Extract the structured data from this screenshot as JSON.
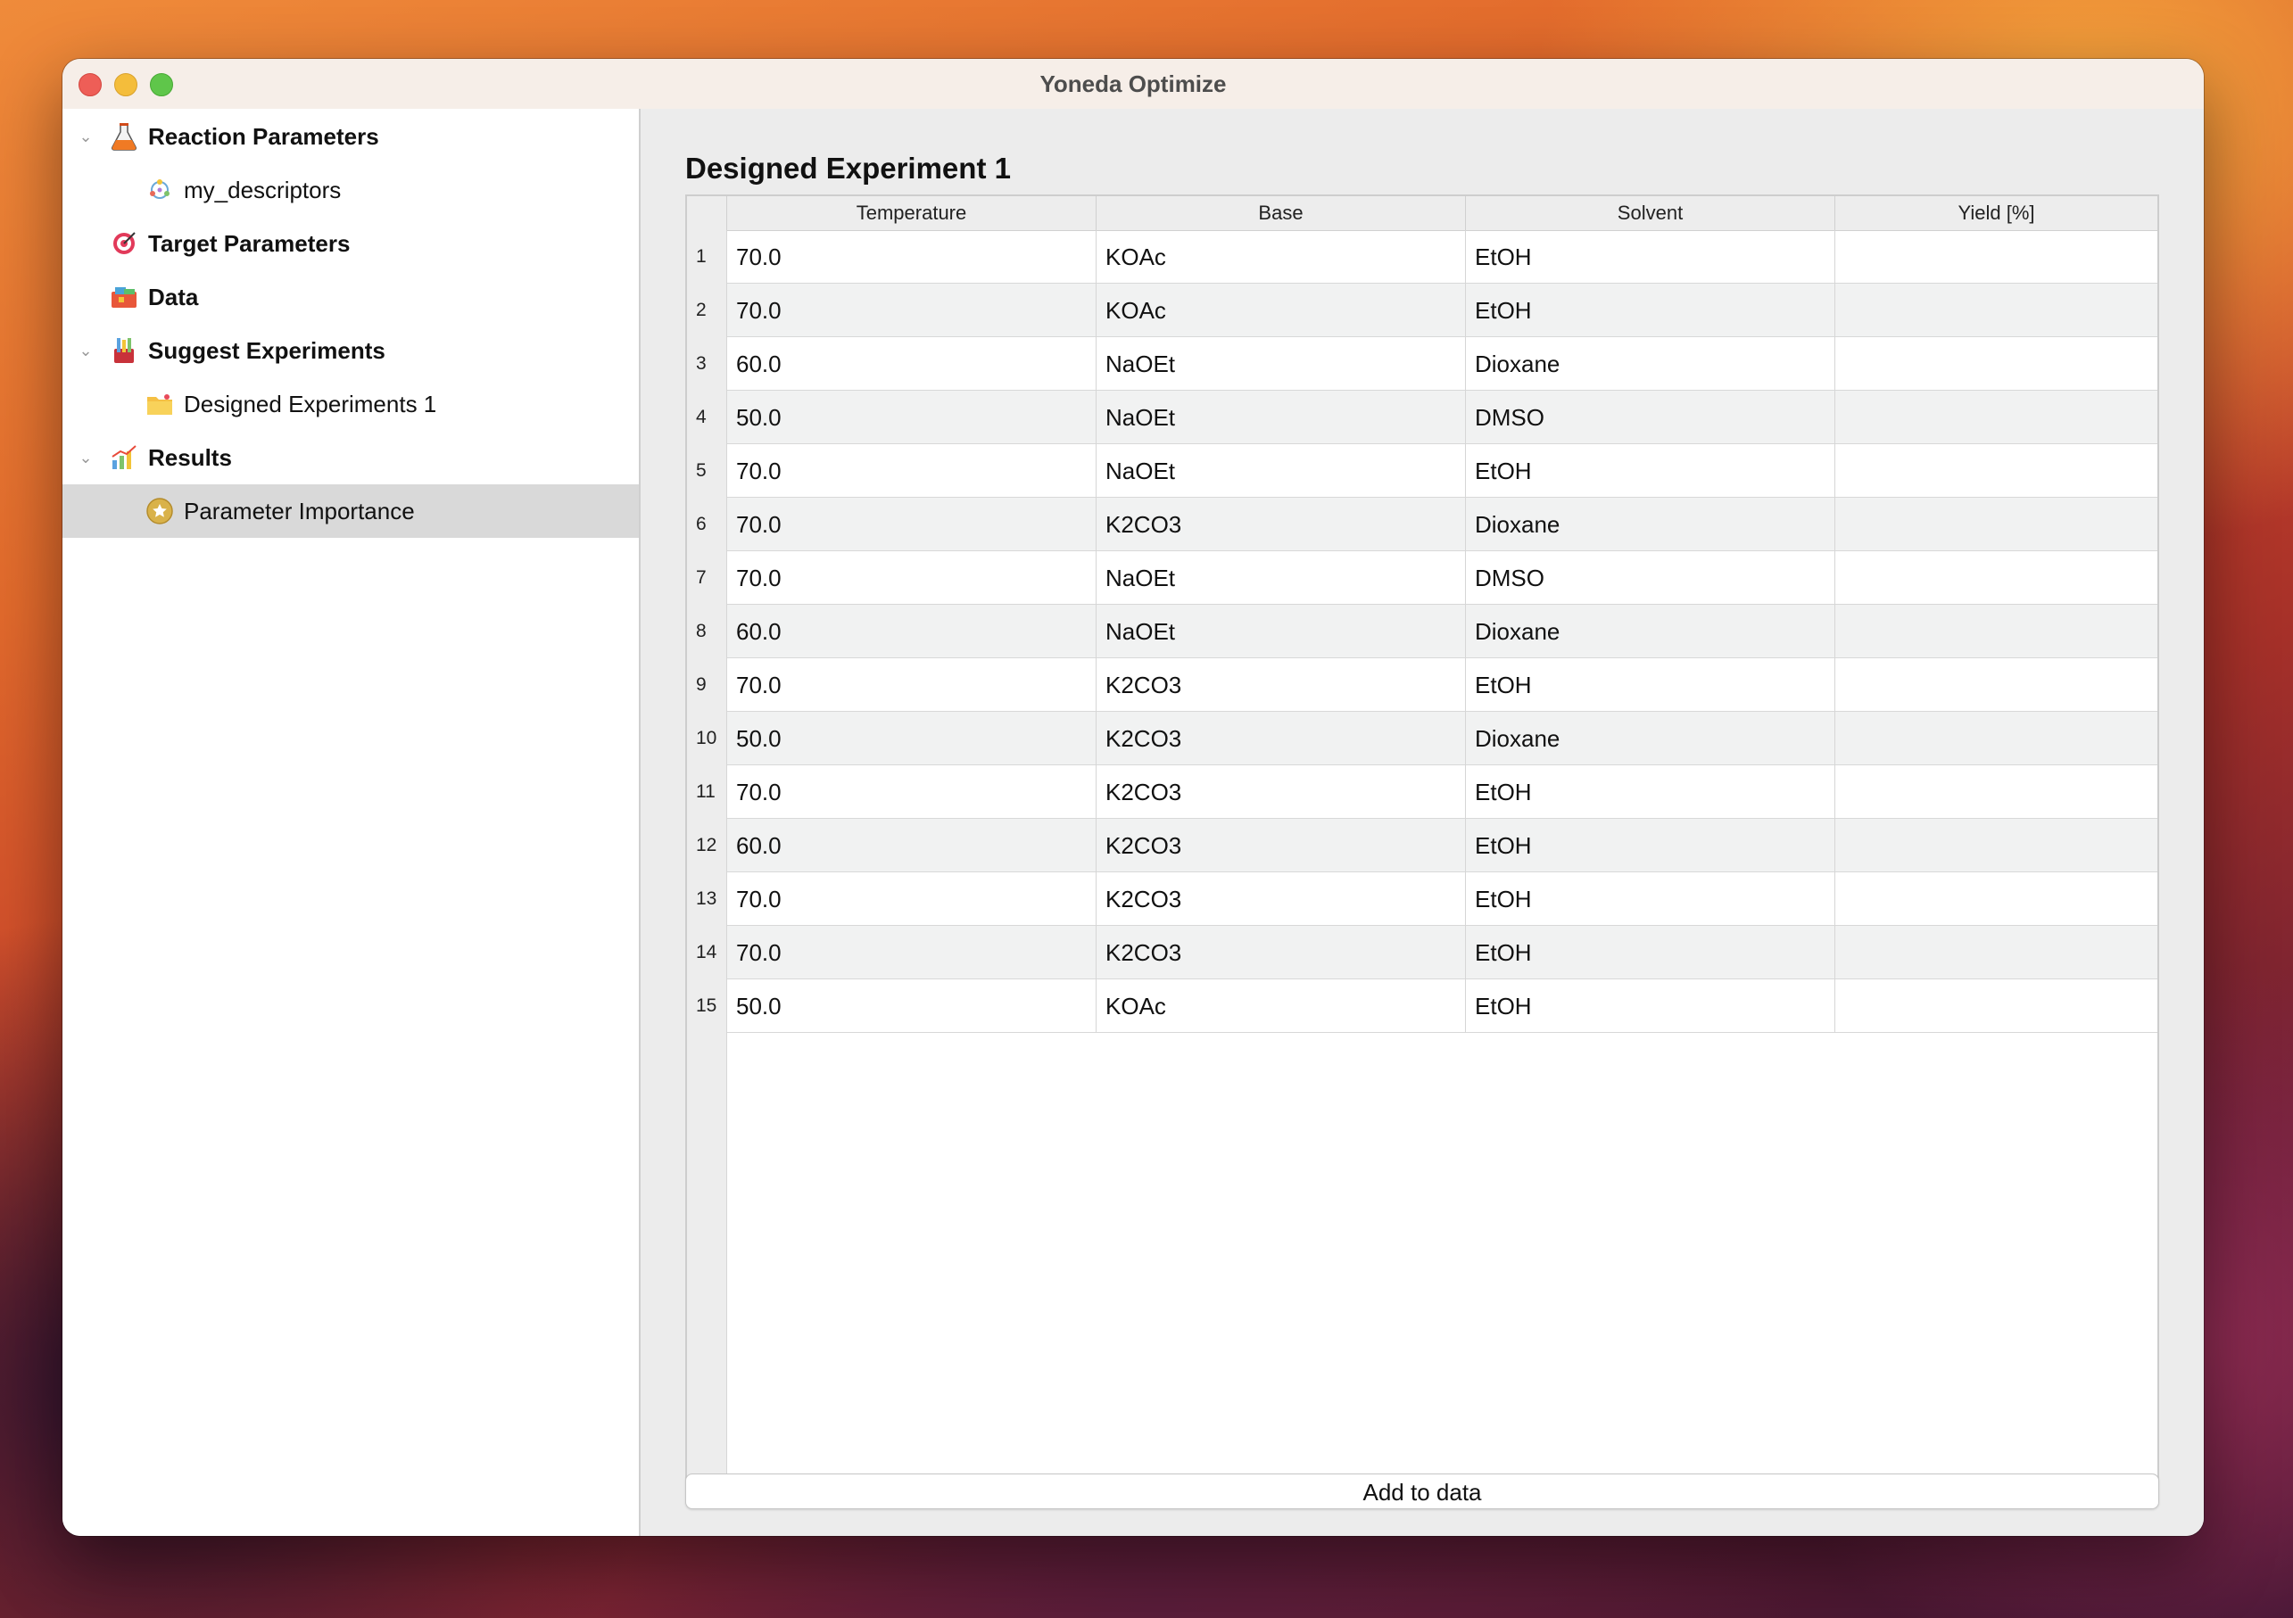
{
  "window": {
    "title": "Yoneda Optimize"
  },
  "sidebar": {
    "items": [
      {
        "label": "Reaction Parameters",
        "icon": "flask-icon",
        "level": 0,
        "bold": true,
        "expanded": true
      },
      {
        "label": "my_descriptors",
        "icon": "molecule-icon",
        "level": 1,
        "bold": false
      },
      {
        "label": "Target Parameters",
        "icon": "target-icon",
        "level": 0,
        "bold": true
      },
      {
        "label": "Data",
        "icon": "data-icon",
        "level": 0,
        "bold": true
      },
      {
        "label": "Suggest Experiments",
        "icon": "test-tubes-icon",
        "level": 0,
        "bold": true,
        "expanded": true
      },
      {
        "label": "Designed Experiments 1",
        "icon": "folder-icon",
        "level": 1,
        "bold": false
      },
      {
        "label": "Results",
        "icon": "chart-icon",
        "level": 0,
        "bold": true,
        "expanded": true
      },
      {
        "label": "Parameter Importance",
        "icon": "star-icon",
        "level": 1,
        "bold": false,
        "selected": true
      }
    ]
  },
  "main": {
    "heading": "Designed Experiment 1",
    "table": {
      "columns": [
        "Temperature",
        "Base",
        "Solvent",
        "Yield [%]"
      ],
      "rows": [
        {
          "n": "1",
          "cells": [
            "70.0",
            "KOAc",
            "EtOH",
            ""
          ]
        },
        {
          "n": "2",
          "cells": [
            "70.0",
            "KOAc",
            "EtOH",
            ""
          ]
        },
        {
          "n": "3",
          "cells": [
            "60.0",
            "NaOEt",
            "Dioxane",
            ""
          ]
        },
        {
          "n": "4",
          "cells": [
            "50.0",
            "NaOEt",
            "DMSO",
            ""
          ]
        },
        {
          "n": "5",
          "cells": [
            "70.0",
            "NaOEt",
            "EtOH",
            ""
          ]
        },
        {
          "n": "6",
          "cells": [
            "70.0",
            "K2CO3",
            "Dioxane",
            ""
          ]
        },
        {
          "n": "7",
          "cells": [
            "70.0",
            "NaOEt",
            "DMSO",
            ""
          ]
        },
        {
          "n": "8",
          "cells": [
            "60.0",
            "NaOEt",
            "Dioxane",
            ""
          ]
        },
        {
          "n": "9",
          "cells": [
            "70.0",
            "K2CO3",
            "EtOH",
            ""
          ]
        },
        {
          "n": "10",
          "cells": [
            "50.0",
            "K2CO3",
            "Dioxane",
            ""
          ]
        },
        {
          "n": "11",
          "cells": [
            "70.0",
            "K2CO3",
            "EtOH",
            ""
          ]
        },
        {
          "n": "12",
          "cells": [
            "60.0",
            "K2CO3",
            "EtOH",
            ""
          ]
        },
        {
          "n": "13",
          "cells": [
            "70.0",
            "K2CO3",
            "EtOH",
            ""
          ]
        },
        {
          "n": "14",
          "cells": [
            "70.0",
            "K2CO3",
            "EtOH",
            ""
          ]
        },
        {
          "n": "15",
          "cells": [
            "50.0",
            "KOAc",
            "EtOH",
            ""
          ]
        }
      ]
    },
    "add_button": "Add to data"
  },
  "colors": {
    "selected_row": "#d9d9d9",
    "alt_row": "#f1f2f2"
  }
}
